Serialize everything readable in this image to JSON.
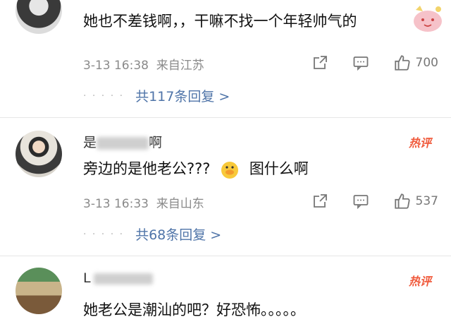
{
  "comments": [
    {
      "text": "她也不差钱啊，，干嘛不找一个年轻帅气的",
      "time": "3-13 16:38",
      "location": "来自江苏",
      "likes": "700",
      "replies_label": "共117条回复 >"
    },
    {
      "username_start": "是",
      "username_end": "啊",
      "hot_badge": "热评",
      "text_before": "旁边的是他老公???",
      "text_after": "图什么啊",
      "time": "3-13 16:33",
      "location": "来自山东",
      "likes": "537",
      "replies_label": "共68条回复 >"
    },
    {
      "username_start": "L",
      "hot_badge": "热评",
      "text": "她老公是潮汕的吧？好恐怖。。。。。"
    }
  ],
  "colors": {
    "link": "#4f74a8",
    "hot": "#f05a3c",
    "meta": "#8a8a8a"
  }
}
